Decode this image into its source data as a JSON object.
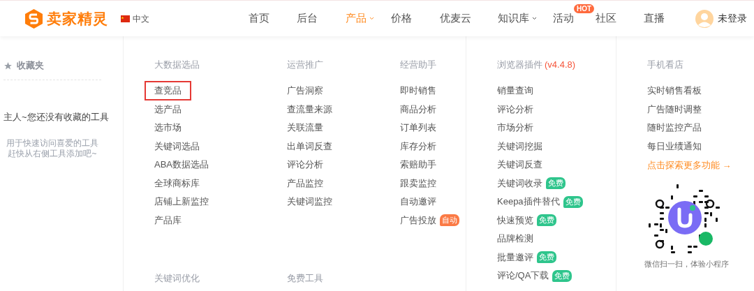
{
  "header": {
    "logo_text": "卖家精灵",
    "language": "中文",
    "nav": [
      {
        "label": "首页",
        "selected": false,
        "dropdown": false
      },
      {
        "label": "后台",
        "selected": false,
        "dropdown": false
      },
      {
        "label": "产品",
        "selected": true,
        "dropdown": true
      },
      {
        "label": "价格",
        "selected": false,
        "dropdown": false
      },
      {
        "label": "优麦云",
        "selected": false,
        "dropdown": false
      },
      {
        "label": "知识库",
        "selected": false,
        "dropdown": true
      },
      {
        "label": "活动",
        "selected": false,
        "dropdown": false,
        "badge": "HOT"
      },
      {
        "label": "社区",
        "selected": false,
        "dropdown": false
      },
      {
        "label": "直播",
        "selected": false,
        "dropdown": false
      }
    ],
    "user_label": "未登录"
  },
  "favorites": {
    "title": "收藏夹",
    "empty_message": "主人~您还没有收藏的工具",
    "hint_lines": [
      "用于快速访问喜爱的工具",
      "赶快从右侧工具添加吧~"
    ]
  },
  "menu_columns": [
    {
      "sections": [
        {
          "heading": "大数据选品",
          "items": [
            {
              "label": "查竞品",
              "highlighted": true
            },
            {
              "label": "选产品",
              "highlighted": false
            },
            {
              "label": "选市场",
              "highlighted": false
            },
            {
              "label": "关键词选品",
              "highlighted": false
            },
            {
              "label": "ABA数据选品",
              "highlighted": false
            },
            {
              "label": "全球商标库",
              "highlighted": false
            },
            {
              "label": "店铺上新监控",
              "highlighted": false
            },
            {
              "label": "产品库",
              "highlighted": false
            }
          ]
        },
        {
          "heading": "关键词优化"
        }
      ]
    },
    {
      "sections": [
        {
          "heading": "运营推广",
          "items": [
            {
              "label": "广告洞察",
              "highlighted": false
            },
            {
              "label": "查流量来源",
              "highlighted": false
            },
            {
              "label": "关联流量",
              "highlighted": false
            },
            {
              "label": "出单词反查",
              "highlighted": false
            },
            {
              "label": "评论分析",
              "highlighted": false
            },
            {
              "label": "产品监控",
              "highlighted": false
            },
            {
              "label": "关键词监控",
              "highlighted": false
            }
          ]
        },
        {
          "heading": "免费工具"
        }
      ]
    },
    {
      "sections": [
        {
          "heading": "经营助手",
          "items": [
            {
              "label": "即时销售",
              "highlighted": false
            },
            {
              "label": "商品分析",
              "highlighted": false
            },
            {
              "label": "订单列表",
              "highlighted": false
            },
            {
              "label": "库存分析",
              "highlighted": false
            },
            {
              "label": "索赔助手",
              "highlighted": false
            },
            {
              "label": "跟卖监控",
              "highlighted": false
            },
            {
              "label": "自动邀评",
              "highlighted": false
            },
            {
              "label": "广告投放",
              "highlighted": false,
              "badge": {
                "text": "自动",
                "color": "#fb7a45"
              }
            }
          ]
        }
      ]
    },
    {
      "sections": [
        {
          "heading": "浏览器插件",
          "version": "(v4.4.8)",
          "items": [
            {
              "label": "销量查询",
              "highlighted": false
            },
            {
              "label": "评论分析",
              "highlighted": false
            },
            {
              "label": "市场分析",
              "highlighted": false
            },
            {
              "label": "关键词挖掘",
              "highlighted": false
            },
            {
              "label": "关键词反查",
              "highlighted": false
            },
            {
              "label": "关键词收录",
              "highlighted": false,
              "badge": {
                "text": "免费",
                "color": "#2ec58c"
              }
            },
            {
              "label": "Keepa插件替代",
              "highlighted": false,
              "badge": {
                "text": "免费",
                "color": "#2ec58c"
              }
            },
            {
              "label": "快速预览",
              "highlighted": false,
              "badge": {
                "text": "免费",
                "color": "#2ec58c"
              }
            },
            {
              "label": "品牌检测",
              "highlighted": false
            },
            {
              "label": "批量邀评",
              "highlighted": false,
              "badge": {
                "text": "免费",
                "color": "#2ec58c"
              }
            },
            {
              "label": "评论/QA下载",
              "highlighted": false,
              "badge": {
                "text": "免费",
                "color": "#2ec58c"
              }
            }
          ]
        }
      ]
    },
    {
      "sections": [
        {
          "heading": "手机看店",
          "items": [
            {
              "label": "实时销售看板",
              "highlighted": false
            },
            {
              "label": "广告随时调整",
              "highlighted": false
            },
            {
              "label": "随时监控产品",
              "highlighted": false
            },
            {
              "label": "每日业绩通知",
              "highlighted": false
            }
          ],
          "more_link": "点击探索更多功能 →",
          "qr_caption": "微信扫一扫，体验小程序"
        }
      ]
    }
  ]
}
